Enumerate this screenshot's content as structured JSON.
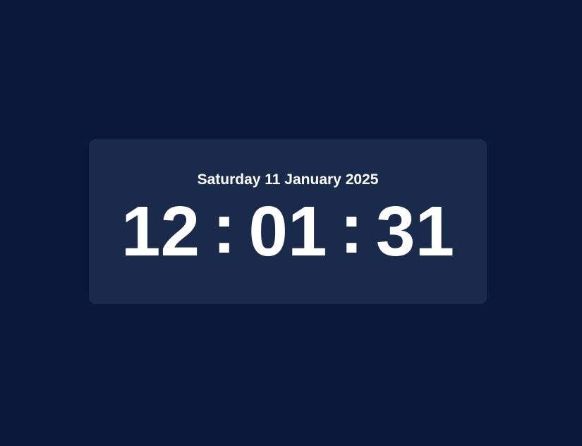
{
  "clock": {
    "date": "Saturday 11 January 2025",
    "hours": "12",
    "minutes": "01",
    "seconds": "31",
    "separator": ":"
  },
  "colors": {
    "background": "#0c1839",
    "card": "#1a2a4a",
    "text": "#ffffff"
  }
}
